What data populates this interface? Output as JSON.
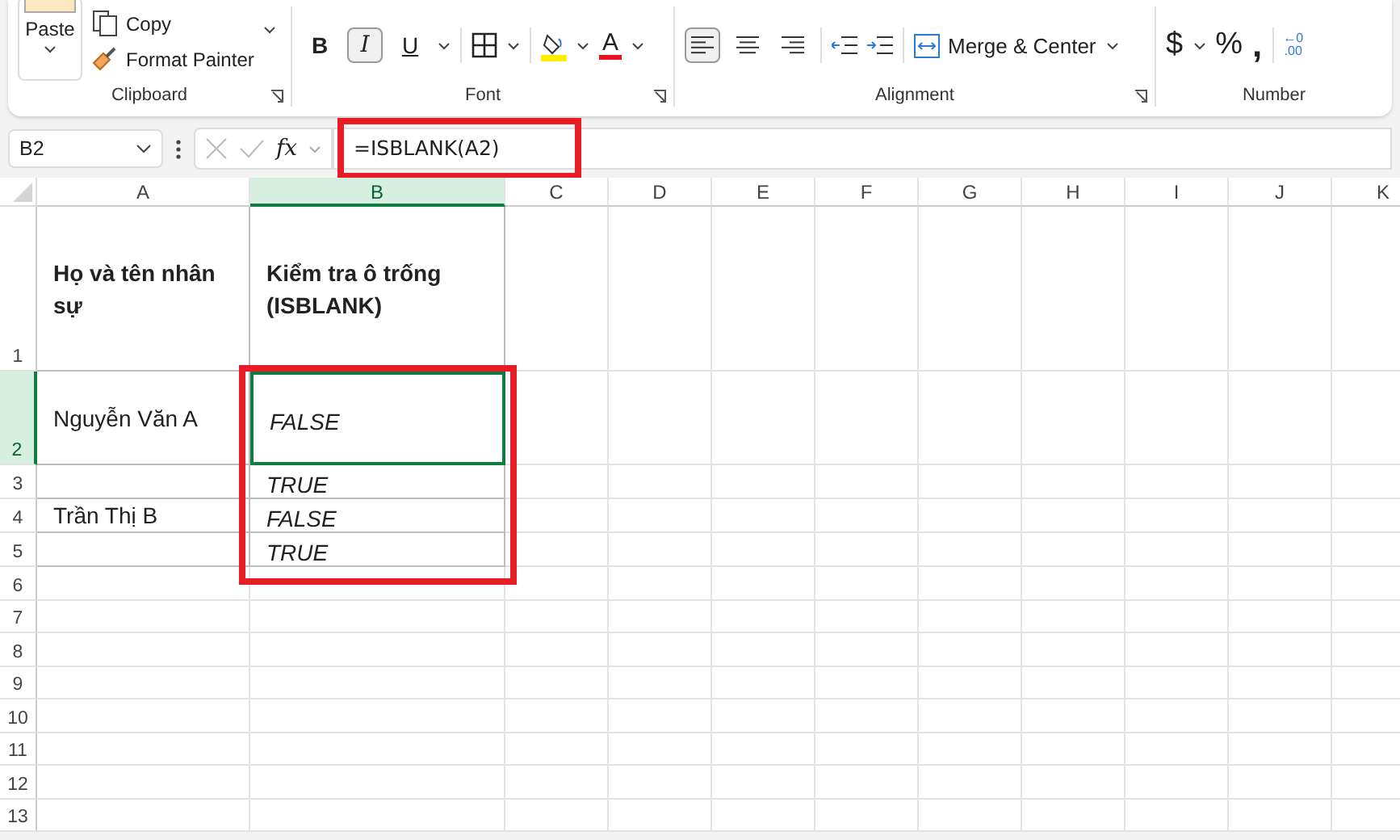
{
  "ribbon": {
    "clipboard": {
      "paste": "Paste",
      "copy": "Copy",
      "format_painter": "Format Painter",
      "label": "Clipboard"
    },
    "font": {
      "label": "Font",
      "styles": [
        {
          "text": "B",
          "kind": "bold",
          "selected": false
        },
        {
          "text": "I",
          "kind": "italic",
          "selected": true
        },
        {
          "text": "U",
          "kind": "underline",
          "selected": false
        }
      ],
      "font_color_letter": "A"
    },
    "alignment": {
      "label": "Alignment",
      "aligns": [
        {
          "kind": "left",
          "selected": true
        },
        {
          "kind": "center",
          "selected": false
        },
        {
          "kind": "right",
          "selected": false
        }
      ],
      "merge": "Merge & Center"
    },
    "number": {
      "label": "Number",
      "currency": "$",
      "percent": "%",
      "comma": ",",
      "decimal": {
        "top": "←0",
        "bottom": ".00"
      }
    }
  },
  "formula_bar": {
    "name_box": "B2",
    "fx": "fx",
    "formula": "=ISBLANK(A2)"
  },
  "sheet": {
    "columns": [
      {
        "label": "A",
        "selected": false
      },
      {
        "label": "B",
        "selected": true
      },
      {
        "label": "C",
        "selected": false
      },
      {
        "label": "D",
        "selected": false
      },
      {
        "label": "E",
        "selected": false
      },
      {
        "label": "F",
        "selected": false
      },
      {
        "label": "G",
        "selected": false
      },
      {
        "label": "H",
        "selected": false
      },
      {
        "label": "I",
        "selected": false
      },
      {
        "label": "J",
        "selected": false
      },
      {
        "label": "K",
        "selected": false
      }
    ],
    "rows": [
      {
        "label": "1",
        "selected": false,
        "a": {
          "text": "Họ và tên nhân sự",
          "kind": "heading",
          "selected": false
        },
        "b": {
          "text": "Kiểm tra ô trống (ISBLANK)",
          "kind": "heading",
          "selected": false
        }
      },
      {
        "label": "2",
        "selected": true,
        "a": {
          "text": "Nguyễn Văn A",
          "kind": "name",
          "selected": false
        },
        "b": {
          "text": "FALSE",
          "kind": "result",
          "selected": true
        }
      },
      {
        "label": "3",
        "selected": false,
        "b": {
          "text": "TRUE",
          "kind": "result",
          "selected": false
        }
      },
      {
        "label": "4",
        "selected": false,
        "a": {
          "text": "Trần Thị B",
          "kind": "name",
          "selected": false
        },
        "b": {
          "text": "FALSE",
          "kind": "result",
          "selected": false
        }
      },
      {
        "label": "5",
        "selected": false,
        "b": {
          "text": "TRUE",
          "kind": "result",
          "selected": false
        }
      },
      {
        "label": "6",
        "selected": false
      },
      {
        "label": "7",
        "selected": false
      },
      {
        "label": "8",
        "selected": false
      },
      {
        "label": "9",
        "selected": false
      },
      {
        "label": "10",
        "selected": false
      },
      {
        "label": "11",
        "selected": false
      },
      {
        "label": "12",
        "selected": false
      },
      {
        "label": "13",
        "selected": false
      }
    ]
  }
}
